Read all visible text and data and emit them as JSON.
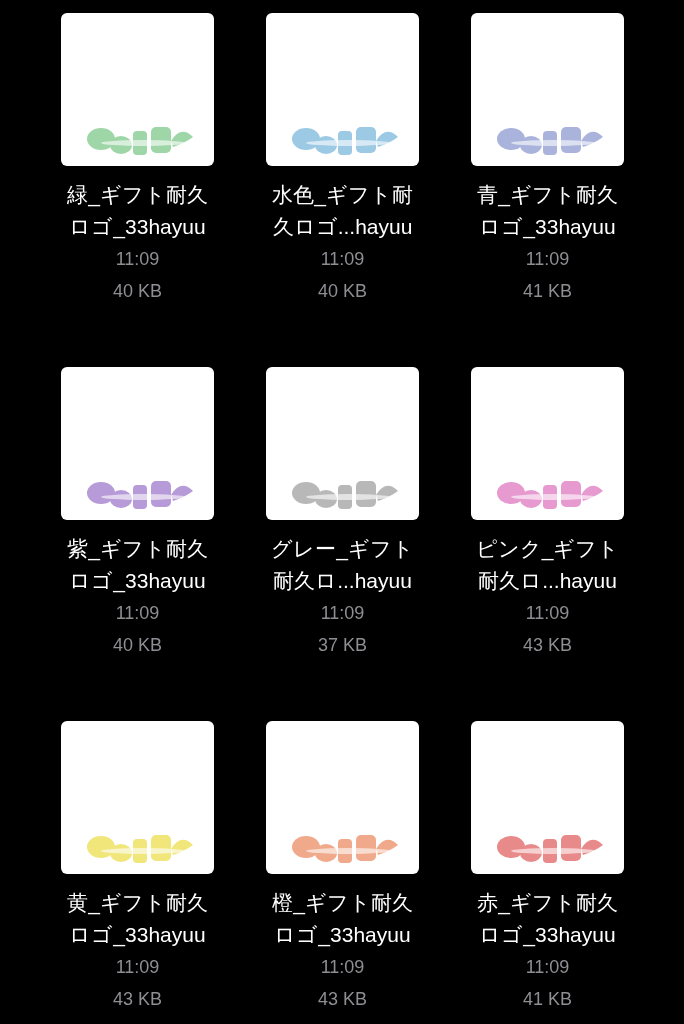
{
  "files": [
    {
      "name": [
        "緑_ギフト耐久",
        "ロゴ_33hayuu"
      ],
      "time": "11:09",
      "size": "40 KB"
    },
    {
      "name": [
        "水色_ギフト耐",
        "久ロゴ...hayuu"
      ],
      "time": "11:09",
      "size": "40 KB"
    },
    {
      "name": [
        "青_ギフト耐久",
        "ロゴ_33hayuu"
      ],
      "time": "11:09",
      "size": "41 KB"
    },
    {
      "name": [
        "紫_ギフト耐久",
        "ロゴ_33hayuu"
      ],
      "time": "11:09",
      "size": "40 KB"
    },
    {
      "name": [
        "グレー_ギフト",
        "耐久ロ...hayuu"
      ],
      "time": "11:09",
      "size": "37 KB"
    },
    {
      "name": [
        "ピンク_ギフト",
        "耐久ロ...hayuu"
      ],
      "time": "11:09",
      "size": "43 KB"
    },
    {
      "name": [
        "黄_ギフト耐久",
        "ロゴ_33hayuu"
      ],
      "time": "11:09",
      "size": "43 KB"
    },
    {
      "name": [
        "橙_ギフト耐久",
        "ロゴ_33hayuu"
      ],
      "time": "11:09",
      "size": "43 KB"
    },
    {
      "name": [
        "赤_ギフト耐久",
        "ロゴ_33hayuu"
      ],
      "time": "11:09",
      "size": "41 KB"
    }
  ]
}
